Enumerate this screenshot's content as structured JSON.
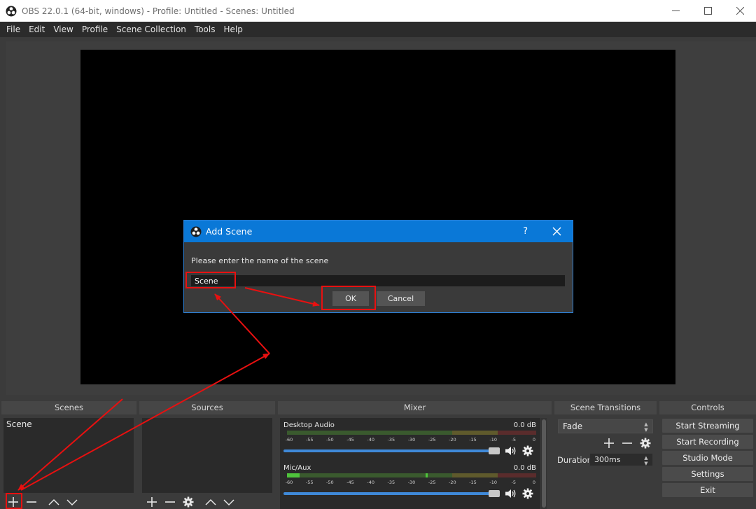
{
  "window": {
    "title": "OBS 22.0.1 (64-bit, windows) - Profile: Untitled - Scenes: Untitled"
  },
  "menu": [
    "File",
    "Edit",
    "View",
    "Profile",
    "Scene Collection",
    "Tools",
    "Help"
  ],
  "docks": {
    "scenes": {
      "title": "Scenes",
      "items": [
        "Scene"
      ]
    },
    "sources": {
      "title": "Sources"
    },
    "mixer": {
      "title": "Mixer",
      "channels": [
        {
          "name": "Desktop Audio",
          "db": "0.0 dB",
          "level": 0.0
        },
        {
          "name": "Mic/Aux",
          "db": "0.0 dB",
          "level": 0.06
        }
      ],
      "ticks": [
        "-60",
        "-55",
        "-50",
        "-45",
        "-40",
        "-35",
        "-30",
        "-25",
        "-20",
        "-15",
        "-10",
        "-5",
        "0"
      ]
    },
    "transitions": {
      "title": "Scene Transitions",
      "selected": "Fade",
      "duration_label": "Duration",
      "duration_value": "300ms"
    },
    "controls": {
      "title": "Controls",
      "buttons": [
        "Start Streaming",
        "Start Recording",
        "Studio Mode",
        "Settings",
        "Exit"
      ]
    }
  },
  "dialog": {
    "title": "Add Scene",
    "help": "?",
    "prompt": "Please enter the name of the scene",
    "input_value": "Scene",
    "ok_label": "OK",
    "cancel_label": "Cancel"
  },
  "colors": {
    "accent": "#0a78d7",
    "annotation": "#e81010",
    "fader": "#3f89d8"
  }
}
